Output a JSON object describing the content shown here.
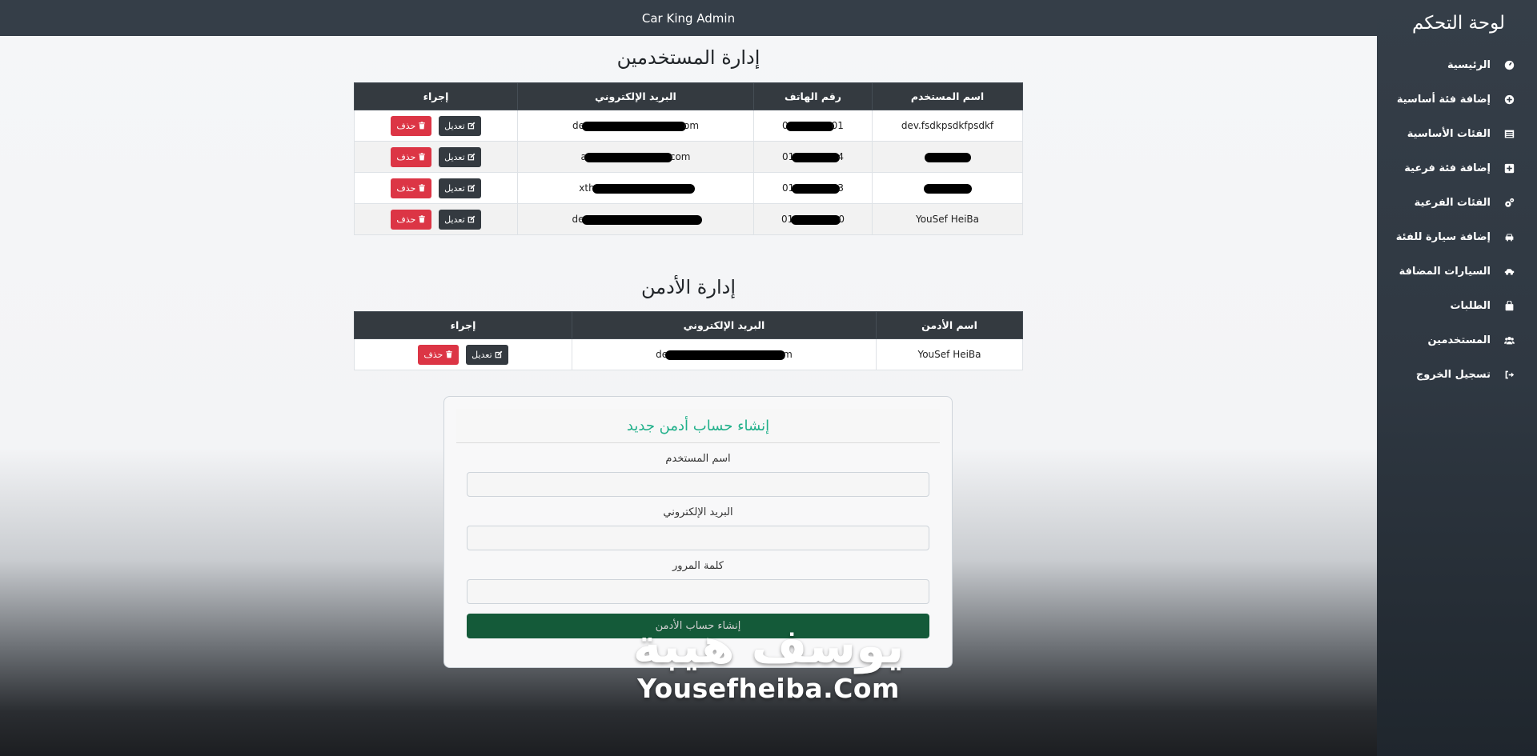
{
  "header": {
    "title": "Car King Admin"
  },
  "sidebar": {
    "title": "لوحة التحكم",
    "items": [
      {
        "label": "الرئيسية",
        "icon": "tachometer-icon"
      },
      {
        "label": "إضافة فئة أساسية",
        "icon": "plus-circle-icon"
      },
      {
        "label": "الفئات الأساسية",
        "icon": "table-icon"
      },
      {
        "label": "إضافة فئة فرعية",
        "icon": "plus-square-icon"
      },
      {
        "label": "الفئات الفرعية",
        "icon": "gears-icon"
      },
      {
        "label": "إضافة سيارة للفئة",
        "icon": "car-icon"
      },
      {
        "label": "السيارات المضافة",
        "icon": "car-side-icon"
      },
      {
        "label": "الطلبات",
        "icon": "bag-icon"
      },
      {
        "label": "المستخدمين",
        "icon": "users-icon"
      },
      {
        "label": "تسجيل الخروج",
        "icon": "sign-out-icon"
      }
    ]
  },
  "users_section": {
    "title": "إدارة المستخدمين",
    "columns": [
      "اسم المستخدم",
      "رقم الهاتف",
      "البريد الإلكتروني",
      "إجراء"
    ],
    "rows": [
      {
        "username": "dev.fsdkpsdkfpsdkf",
        "phone_pre": "0",
        "phone_post": "01",
        "email_pre": "de",
        "email_post": "om"
      },
      {
        "username": "",
        "phone_pre": "01",
        "phone_post": "4",
        "email_pre": "a",
        "email_post": "com"
      },
      {
        "username": "",
        "phone_pre": "01",
        "phone_post": "3",
        "email_pre": "xth",
        "email_post": ""
      },
      {
        "username": "YouSef HeiBa",
        "phone_pre": "01",
        "phone_post": "0",
        "email_pre": "de",
        "email_post": ""
      }
    ],
    "edit_label": "تعديل",
    "delete_label": "حذف"
  },
  "admins_section": {
    "title": "إدارة الأدمن",
    "columns": [
      "اسم الأدمن",
      "البريد الإلكتروني",
      "إجراء"
    ],
    "rows": [
      {
        "name": "YouSef HeiBa",
        "email_pre": "de",
        "email_post": "m"
      }
    ],
    "edit_label": "تعديل",
    "delete_label": "حذف"
  },
  "create_admin": {
    "title": "إنشاء حساب أدمن جديد",
    "username_label": "اسم المستخدم",
    "email_label": "البريد الإلكتروني",
    "password_label": "كلمة المرور",
    "submit_label": "إنشاء حساب الأدمن"
  },
  "watermark": {
    "arabic": "يوسف هيبة",
    "english": "Yousefheiba.Com"
  },
  "colors": {
    "topbar": "#353e48",
    "danger": "#dc3545",
    "dark": "#343a40",
    "accent": "#20b08a",
    "submit": "#145a39"
  }
}
